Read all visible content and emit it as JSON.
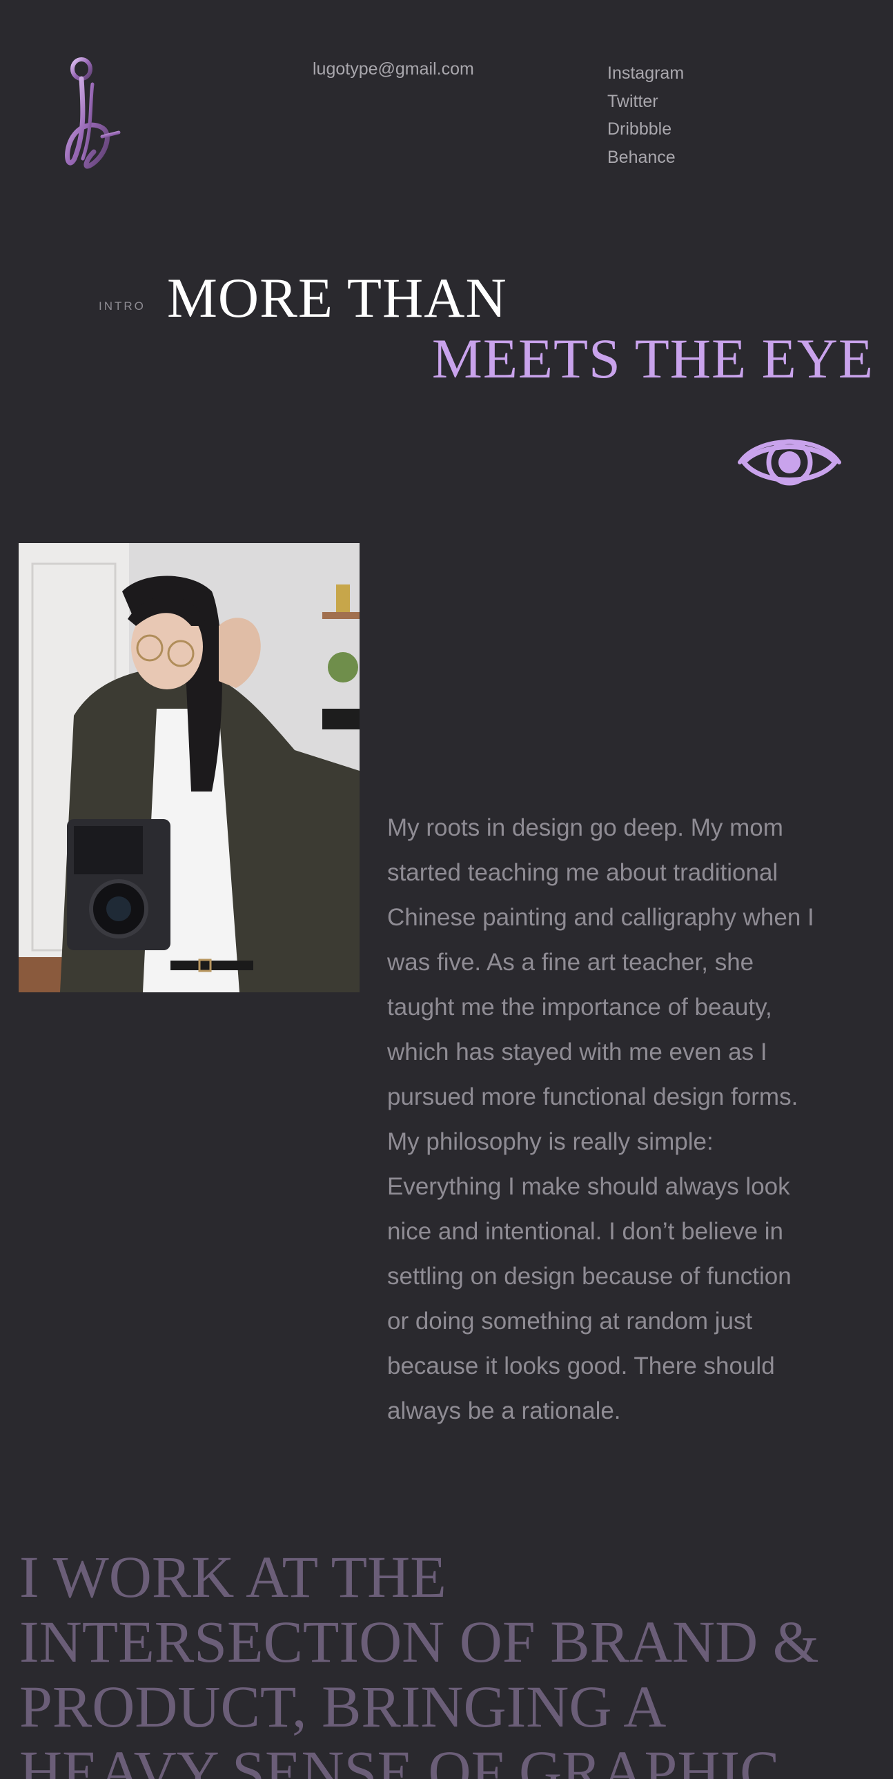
{
  "header": {
    "logo_icon": "monogram-g-logo",
    "email": "lugotype@gmail.com",
    "social": [
      "Instagram",
      "Twitter",
      "Dribbble",
      "Behance"
    ]
  },
  "intro": {
    "label": "INTRO",
    "heading_line1": "MORE THAN",
    "heading_line2": "MEETS THE EYE",
    "eye_icon": "eye-icon"
  },
  "about": {
    "photo": "portrait-with-camera",
    "bio_lines": [
      "My roots in design go deep. My mom",
      "started teaching me about traditional",
      "Chinese painting and calligraphy when I",
      "was five. As a fine art teacher, she",
      "taught me the importance of beauty,",
      "which has stayed with me even as I",
      "pursued more functional design forms.",
      "My philosophy is really simple:",
      "Everything I make should always look",
      "nice and intentional. I don’t believe in",
      "settling on design because of function",
      "or doing something at random just",
      "because it looks good. There should",
      "always be a rationale."
    ]
  },
  "statement": {
    "lines": [
      "I WORK AT THE",
      "INTERSECTION OF BRAND &",
      "PRODUCT, BRINGING A",
      "HEAVY SENSE OF GRAPHIC"
    ]
  },
  "colors": {
    "background": "#2a292e",
    "accent": "#c9a3ec",
    "muted_text": "#8f8c94",
    "statement_text": "#6b5e78"
  }
}
